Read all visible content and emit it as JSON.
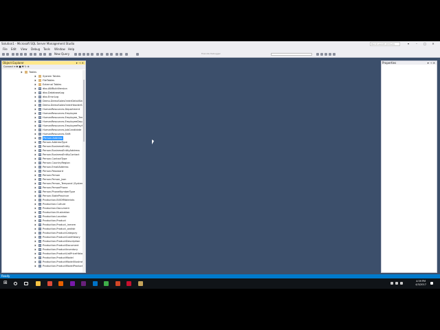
{
  "window": {
    "title": "Solution1 - Microsoft SQL Server Management Studio",
    "quick_launch_placeholder": "Quick Launch (Ctrl+Q)"
  },
  "menu": [
    "File",
    "Edit",
    "View",
    "Debug",
    "Tools",
    "Window",
    "Help"
  ],
  "toolbar": {
    "new_query_label": "New Query",
    "execute_dropdown": "Execute Debugger",
    "combo_value": ""
  },
  "object_explorer": {
    "title": "Object Explorer",
    "connect_label": "Connect",
    "items": [
      {
        "label": "Tables",
        "type": "folder",
        "level": 0
      },
      {
        "label": "System Tables",
        "type": "folder",
        "level": 1
      },
      {
        "label": "FileTables",
        "type": "folder",
        "level": 1
      },
      {
        "label": "External Tables",
        "type": "folder",
        "level": 1
      },
      {
        "label": "dbo.AWBuildVersion",
        "type": "table",
        "level": 1
      },
      {
        "label": "dbo.DatabaseLog",
        "type": "table",
        "level": 1
      },
      {
        "label": "dbo.ErrorLog",
        "type": "table",
        "level": 1
      },
      {
        "label": "Demo.DemoSalesOrderDetailSeed",
        "type": "table",
        "level": 1
      },
      {
        "label": "Demo.DemoSalesOrderHeaderSeed",
        "type": "table",
        "level": 1
      },
      {
        "label": "HumanResources.Department",
        "type": "table",
        "level": 1
      },
      {
        "label": "HumanResources.Employee",
        "type": "table",
        "level": 1
      },
      {
        "label": "HumanResources.Employee_Temporal (System-Versioned)",
        "type": "table",
        "level": 1
      },
      {
        "label": "HumanResources.EmployeeDepartmentHistory",
        "type": "table",
        "level": 1
      },
      {
        "label": "HumanResources.EmployeePayHistory",
        "type": "table",
        "level": 1
      },
      {
        "label": "HumanResources.JobCandidate",
        "type": "table",
        "level": 1
      },
      {
        "label": "HumanResources.Shift",
        "type": "table",
        "level": 1
      },
      {
        "label": "Person.Address",
        "type": "table",
        "level": 1,
        "selected": true
      },
      {
        "label": "Person.AddressType",
        "type": "table",
        "level": 1
      },
      {
        "label": "Person.BusinessEntity",
        "type": "table",
        "level": 1
      },
      {
        "label": "Person.BusinessEntityAddress",
        "type": "table",
        "level": 1
      },
      {
        "label": "Person.BusinessEntityContact",
        "type": "table",
        "level": 1
      },
      {
        "label": "Person.ContactType",
        "type": "table",
        "level": 1
      },
      {
        "label": "Person.CountryRegion",
        "type": "table",
        "level": 1
      },
      {
        "label": "Person.EmailAddress",
        "type": "table",
        "level": 1
      },
      {
        "label": "Person.Password",
        "type": "table",
        "level": 1
      },
      {
        "label": "Person.Person",
        "type": "table",
        "level": 1
      },
      {
        "label": "Person.Person_json",
        "type": "table",
        "level": 1
      },
      {
        "label": "Person.Person_Temporal (System-Versioned)",
        "type": "table",
        "level": 1
      },
      {
        "label": "Person.PersonPhone",
        "type": "table",
        "level": 1
      },
      {
        "label": "Person.PhoneNumberType",
        "type": "table",
        "level": 1
      },
      {
        "label": "Person.StateProvince",
        "type": "table",
        "level": 1
      },
      {
        "label": "Production.BillOfMaterials",
        "type": "table",
        "level": 1
      },
      {
        "label": "Production.Culture",
        "type": "table",
        "level": 1
      },
      {
        "label": "Production.Document",
        "type": "table",
        "level": 1
      },
      {
        "label": "Production.Illustration",
        "type": "table",
        "level": 1
      },
      {
        "label": "Production.Location",
        "type": "table",
        "level": 1
      },
      {
        "label": "Production.Product",
        "type": "table",
        "level": 1
      },
      {
        "label": "Production.Product_inmem",
        "type": "table",
        "level": 1
      },
      {
        "label": "Production.Product_ondisk",
        "type": "table",
        "level": 1
      },
      {
        "label": "Production.ProductCategory",
        "type": "table",
        "level": 1
      },
      {
        "label": "Production.ProductCostHistory",
        "type": "table",
        "level": 1
      },
      {
        "label": "Production.ProductDescription",
        "type": "table",
        "level": 1
      },
      {
        "label": "Production.ProductDocument",
        "type": "table",
        "level": 1
      },
      {
        "label": "Production.ProductInventory",
        "type": "table",
        "level": 1
      },
      {
        "label": "Production.ProductListPriceHistory",
        "type": "table",
        "level": 1
      },
      {
        "label": "Production.ProductModel",
        "type": "table",
        "level": 1
      },
      {
        "label": "Production.ProductModelIllustration",
        "type": "table",
        "level": 1
      },
      {
        "label": "Production.ProductModelProductDescriptionCulture",
        "type": "table",
        "level": 1
      }
    ]
  },
  "properties": {
    "title": "Properties"
  },
  "status": {
    "text": "Ready"
  },
  "taskbar": {
    "time": "4:59 PM",
    "date": "4/3/2017",
    "apps": [
      {
        "name": "file-explorer-icon",
        "color": "#f6c343"
      },
      {
        "name": "chrome-icon",
        "color": "#dd4b39"
      },
      {
        "name": "firefox-icon",
        "color": "#e66000"
      },
      {
        "name": "onenote-icon",
        "color": "#7719aa"
      },
      {
        "name": "visual-studio-icon",
        "color": "#68217a"
      },
      {
        "name": "outlook-icon",
        "color": "#0072c6"
      },
      {
        "name": "camtasia-icon",
        "color": "#3fae49"
      },
      {
        "name": "powerpoint-icon",
        "color": "#d24726"
      },
      {
        "name": "acrobat-icon",
        "color": "#c8102e"
      },
      {
        "name": "ssms-icon",
        "color": "#c4a35a"
      }
    ]
  }
}
